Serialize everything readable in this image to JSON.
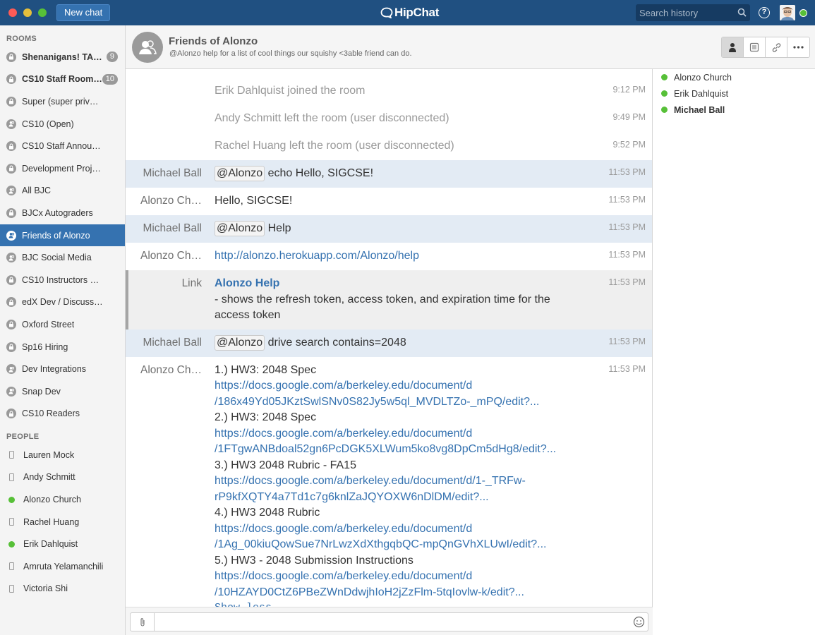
{
  "app": {
    "name": "HipChat",
    "new_chat": "New chat",
    "search_placeholder": "Search history"
  },
  "sidebar": {
    "rooms_heading": "ROOMS",
    "rooms": [
      {
        "label": "Shenanigans! TAs…",
        "bold": true,
        "badge": "9",
        "icon": "lock-icon"
      },
      {
        "label": "CS10 Staff Room…",
        "bold": true,
        "badge": "10",
        "icon": "lock-icon"
      },
      {
        "label": "Super (super privat…",
        "icon": "lock-icon"
      },
      {
        "label": "CS10 (Open)",
        "icon": "people-icon"
      },
      {
        "label": "CS10 Staff Announ…",
        "icon": "lock-icon"
      },
      {
        "label": "Development Proje…",
        "icon": "lock-icon"
      },
      {
        "label": "All BJC",
        "icon": "people-icon"
      },
      {
        "label": "BJCx Autograders",
        "icon": "lock-icon"
      },
      {
        "label": "Friends of Alonzo",
        "active": true,
        "icon": "people-icon"
      },
      {
        "label": "BJC Social Media",
        "icon": "people-icon"
      },
      {
        "label": "CS10 Instructors O…",
        "icon": "lock-icon"
      },
      {
        "label": "edX Dev / Discussion",
        "icon": "lock-icon"
      },
      {
        "label": "Oxford Street",
        "icon": "lock-icon"
      },
      {
        "label": "Sp16 Hiring",
        "icon": "lock-icon"
      },
      {
        "label": "Dev Integrations",
        "icon": "people-icon"
      },
      {
        "label": "Snap Dev",
        "icon": "people-icon"
      },
      {
        "label": "CS10 Readers",
        "icon": "lock-icon"
      }
    ],
    "people_heading": "PEOPLE",
    "people": [
      {
        "label": "Lauren Mock",
        "status": "mobile"
      },
      {
        "label": "Andy Schmitt",
        "status": "mobile"
      },
      {
        "label": "Alonzo Church",
        "status": "online"
      },
      {
        "label": "Rachel Huang",
        "status": "mobile"
      },
      {
        "label": "Erik Dahlquist",
        "status": "online"
      },
      {
        "label": "Amruta Yelamanchili",
        "status": "mobile"
      },
      {
        "label": "Victoria Shi",
        "status": "mobile"
      }
    ]
  },
  "room": {
    "name": "Friends of Alonzo",
    "topic": "@Alonzo help for a list of cool things our squishy <3able friend can do."
  },
  "messages": [
    {
      "type": "sys",
      "text": "Erik Dahlquist joined the room",
      "time": "9:12 PM"
    },
    {
      "type": "sys",
      "text": "Andy Schmitt left the room (user disconnected)",
      "time": "9:49 PM"
    },
    {
      "type": "sys",
      "text": "Rachel Huang left the room (user disconnected)",
      "time": "9:52 PM"
    },
    {
      "type": "msg",
      "hl": true,
      "sender": "Michael Ball",
      "mention": "@Alonzo",
      "text": " echo Hello, SIGCSE!",
      "time": "11:53 PM"
    },
    {
      "type": "msg",
      "sender": "Alonzo Ch…",
      "text": "Hello, SIGCSE!",
      "time": "11:53 PM"
    },
    {
      "type": "msg",
      "hl": true,
      "sender": "Michael Ball",
      "mention": "@Alonzo",
      "text": " Help",
      "time": "11:53 PM"
    },
    {
      "type": "msg",
      "sender": "Alonzo Ch…",
      "link": "http://alonzo.herokuapp.com/Alonzo/help",
      "time": "11:53 PM"
    },
    {
      "type": "notif",
      "sender": "Link",
      "title": "Alonzo Help",
      "text": "- shows the refresh token, access token, and expiration time for the access token",
      "time": "11:53 PM"
    },
    {
      "type": "msg",
      "hl": true,
      "sender": "Michael Ball",
      "mention": "@Alonzo",
      "text": " drive search contains=2048",
      "time": "11:53 PM"
    },
    {
      "type": "list",
      "sender": "Alonzo Ch…",
      "time": "11:53 PM",
      "show_less": "Show less",
      "items": [
        {
          "title": "1.) HW3: 2048 Spec",
          "url1": "https://docs.google.com/a/berkeley.edu/document/d",
          "url2": "/186x49Yd05JKztSwlSNv0S82Jy5w5ql_MVDLTZo-_mPQ/edit?..."
        },
        {
          "title": "2.) HW3: 2048 Spec",
          "url1": "https://docs.google.com/a/berkeley.edu/document/d",
          "url2": "/1FTgwANBdoal52gn6PcDGK5XLWum5ko8vg8DpCm5dHg8/edit?..."
        },
        {
          "title": "3.) HW3 2048 Rubric - FA15",
          "url1": "https://docs.google.com/a/berkeley.edu/document/d/1-_TRFw-",
          "url2": "rP9kfXQTY4a7Td1c7g6knlZaJQYOXW6nDlDM/edit?..."
        },
        {
          "title": "4.) HW3 2048 Rubric",
          "url1": "https://docs.google.com/a/berkeley.edu/document/d",
          "url2": "/1Ag_00kiuQowSue7NrLwzXdXthgqbQC-mpQnGVhXLUwI/edit?..."
        },
        {
          "title": "5.) HW3 - 2048 Submission Instructions",
          "url1": "https://docs.google.com/a/berkeley.edu/document/d",
          "url2": "/10HZAYD0CtZ6PBeZWnDdwjhIoH2jZzFlm-5tqIovlw-k/edit?..."
        }
      ]
    }
  ],
  "roster": [
    {
      "name": "Alonzo Church",
      "bold": false
    },
    {
      "name": "Erik Dahlquist",
      "bold": false
    },
    {
      "name": "Michael Ball",
      "bold": true
    }
  ],
  "colors": {
    "brand": "#205081",
    "accent": "#3572b0",
    "online": "#57c038"
  }
}
